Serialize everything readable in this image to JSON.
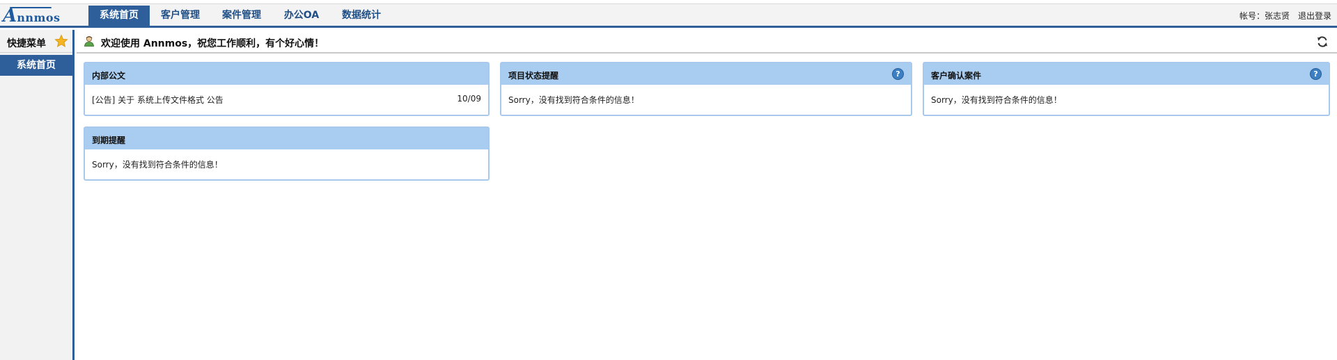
{
  "logo": {
    "first": "A",
    "rest": "nnmos"
  },
  "nav": {
    "tabs": [
      {
        "label": "系统首页",
        "active": true
      },
      {
        "label": "客户管理",
        "active": false
      },
      {
        "label": "案件管理",
        "active": false
      },
      {
        "label": "办公OA",
        "active": false
      },
      {
        "label": "数据统计",
        "active": false
      }
    ]
  },
  "user": {
    "account_label": "帐号：张志贤",
    "logout_label": "退出登录"
  },
  "sidebar": {
    "title": "快捷菜单",
    "items": [
      {
        "label": "系统首页"
      }
    ]
  },
  "welcome": {
    "message": "欢迎使用 Annmos，祝您工作顺利，有个好心情！"
  },
  "panels": {
    "internal_docs": {
      "title": "内部公文",
      "item_text": "[公告] 关于 系统上传文件格式 公告",
      "item_date": "10/09"
    },
    "project_status": {
      "title": "项目状态提醒",
      "help": "?",
      "empty_text": "Sorry，没有找到符合条件的信息！"
    },
    "client_confirm": {
      "title": "客户确认案件",
      "help": "?",
      "empty_text": "Sorry，没有找到符合条件的信息！"
    },
    "expiry": {
      "title": "到期提醒",
      "empty_text": "Sorry，没有找到符合条件的信息！"
    }
  },
  "colors": {
    "brand": "#2e5f9a",
    "panel_header": "#a9cdf0",
    "panel_border": "#a9c9ec"
  },
  "icons": [
    "star-icon",
    "user-icon",
    "refresh-icon",
    "help-icon"
  ]
}
